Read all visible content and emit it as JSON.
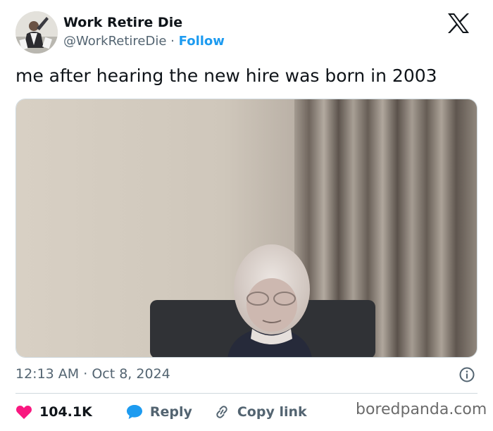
{
  "author": {
    "name": "Work Retire Die",
    "handle": "@WorkRetireDie",
    "separator": "·",
    "follow_label": "Follow"
  },
  "icons": {
    "platform": "x-logo-icon",
    "avatar": "avatar-photo",
    "info": "info-icon",
    "like": "heart-icon",
    "reply": "speech-bubble-icon",
    "copy": "link-icon"
  },
  "tweet": {
    "text": "me after hearing the new hire was born in 2003",
    "media": "photo of an elderly bald man in glasses seated in a dark chair, beige wall and striped curtain behind him"
  },
  "meta": {
    "time": "12:13 AM",
    "separator": "·",
    "date": "Oct 8, 2024"
  },
  "actions": {
    "likes": "104.1K",
    "reply_label": "Reply",
    "copy_label": "Copy link"
  },
  "watermark": "boredpanda.com",
  "colors": {
    "accent": "#1d9bf0",
    "like": "#f91880",
    "secondary_text": "#536471",
    "divider": "#cfd9de"
  }
}
